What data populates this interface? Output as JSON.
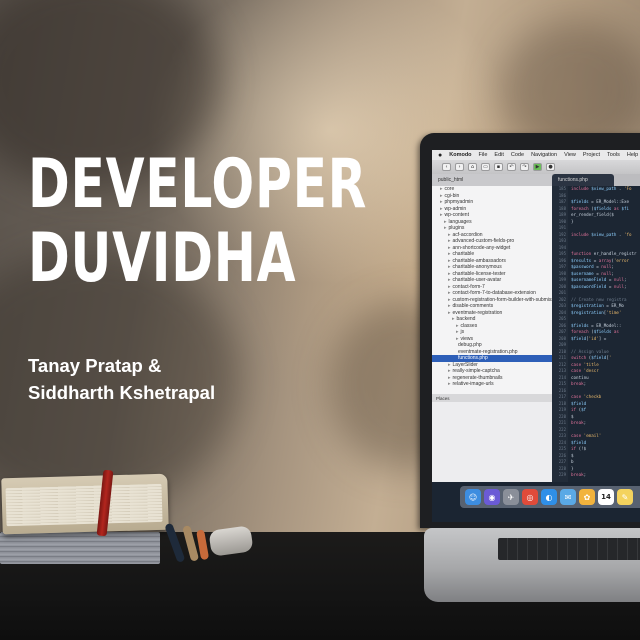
{
  "cover": {
    "title_line1": "DEVELOPER",
    "title_line2": "DUVIDHA",
    "author_line1": "Tanay Pratap &",
    "author_line2": "Siddharth Kshetrapal"
  },
  "laptop_screen": {
    "menubar": {
      "app_name": "Komodo",
      "items": [
        "File",
        "Edit",
        "Code",
        "Navigation",
        "View",
        "Project",
        "Tools",
        "Help"
      ]
    },
    "sidebar_tab": "public_html",
    "file_tab": "functions.php",
    "tree_items": [
      "core",
      "cgi-bin",
      "phpmyadmin",
      "wp-admin",
      "wp-content",
      "languages",
      "plugins",
      "acf-accordion",
      "advanced-custom-fields-pro",
      "ann-shortcode-any-widget",
      "charitable",
      "charitable-ambassadors",
      "charitable-anonymous",
      "charitable-license-tester",
      "charitable-user-avatar",
      "contact-form-7",
      "contact-form-7-to-database-extension",
      "custom-registration-form-builder-with-submiss",
      "disable-comments",
      "eventmate-registration",
      "backend",
      "classes",
      "js",
      "views",
      "debug.php",
      "eventmate-registration.php",
      "functions.php",
      "LayerSlider",
      "really-simple-captcha",
      "regenerate-thumbnails",
      "relative-image-urls"
    ],
    "selected_tree_item": "functions.php",
    "places_label": "Places",
    "code_lines": [
      "include $view_path . 'Fo",
      "",
      "$fields = ER_Model::Exe",
      "foreach ($fields as $fi",
      "    er_render_field($",
      "}",
      "",
      "include $view_path . 'fo",
      "",
      "",
      "function er_handle_registr",
      "    $results = array('error",
      "    $password = null;",
      "    $username = null;",
      "    $usernameField = null;",
      "    $passwordField = null;",
      "",
      "    // Create new registra",
      "    $registration = ER_Mo",
      "    $registration['time'",
      "",
      "    $fields = ER_Model::",
      "    foreach ($fields as",
      "        $field['id'] =",
      "",
      "        // Assign value",
      "        switch ($field['",
      "            case 'title",
      "            case 'descr",
      "                continu",
      "                break;",
      "",
      "            case 'checkb",
      "                $field",
      "                if ($f",
      "                    $",
      "                break;",
      "",
      "            case 'email'",
      "                $field",
      "                if (!$",
      "                    $",
      "                    b",
      "                }",
      "                break;"
    ],
    "line_start": 185,
    "dock_icons": [
      "finder-icon",
      "siri-icon",
      "launchpad-icon",
      "chrome-icon",
      "safari-icon",
      "mail-icon",
      "photos-icon",
      "calendar-icon",
      "notes-icon"
    ],
    "calendar_day": "14"
  }
}
